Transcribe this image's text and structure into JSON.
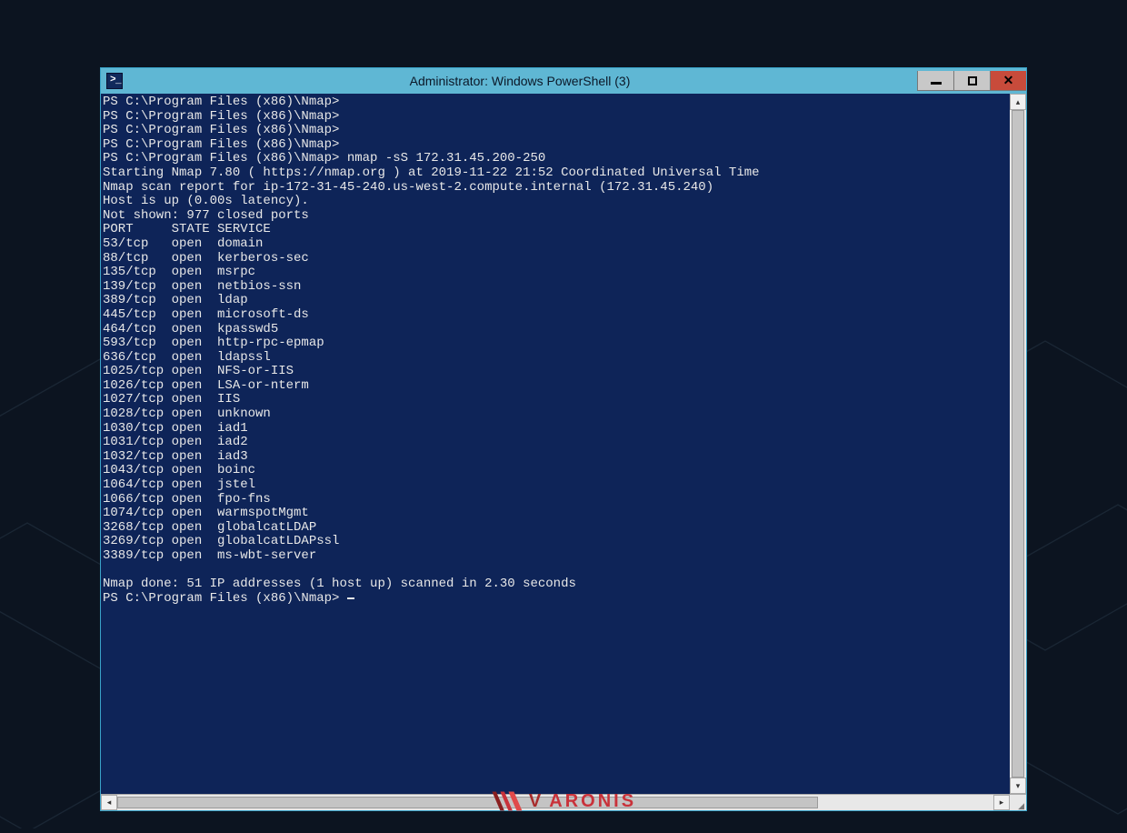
{
  "window": {
    "title": "Administrator: Windows PowerShell (3)"
  },
  "brand": {
    "letter": "V",
    "rest": "ARONIS"
  },
  "terminal": {
    "prompt": "PS C:\\Program Files (x86)\\Nmap>",
    "command": "nmap -sS 172.31.45.200-250",
    "start_line": "Starting Nmap 7.80 ( https://nmap.org ) at 2019-11-22 21:52 Coordinated Universal Time",
    "report_line": "Nmap scan report for ip-172-31-45-240.us-west-2.compute.internal (172.31.45.240)",
    "host_line": "Host is up (0.00s latency).",
    "notshown_line": "Not shown: 977 closed ports",
    "header": {
      "port": "PORT",
      "state": "STATE",
      "service": "SERVICE"
    },
    "ports": [
      {
        "port": "53/tcp",
        "state": "open",
        "service": "domain"
      },
      {
        "port": "88/tcp",
        "state": "open",
        "service": "kerberos-sec"
      },
      {
        "port": "135/tcp",
        "state": "open",
        "service": "msrpc"
      },
      {
        "port": "139/tcp",
        "state": "open",
        "service": "netbios-ssn"
      },
      {
        "port": "389/tcp",
        "state": "open",
        "service": "ldap"
      },
      {
        "port": "445/tcp",
        "state": "open",
        "service": "microsoft-ds"
      },
      {
        "port": "464/tcp",
        "state": "open",
        "service": "kpasswd5"
      },
      {
        "port": "593/tcp",
        "state": "open",
        "service": "http-rpc-epmap"
      },
      {
        "port": "636/tcp",
        "state": "open",
        "service": "ldapssl"
      },
      {
        "port": "1025/tcp",
        "state": "open",
        "service": "NFS-or-IIS"
      },
      {
        "port": "1026/tcp",
        "state": "open",
        "service": "LSA-or-nterm"
      },
      {
        "port": "1027/tcp",
        "state": "open",
        "service": "IIS"
      },
      {
        "port": "1028/tcp",
        "state": "open",
        "service": "unknown"
      },
      {
        "port": "1030/tcp",
        "state": "open",
        "service": "iad1"
      },
      {
        "port": "1031/tcp",
        "state": "open",
        "service": "iad2"
      },
      {
        "port": "1032/tcp",
        "state": "open",
        "service": "iad3"
      },
      {
        "port": "1043/tcp",
        "state": "open",
        "service": "boinc"
      },
      {
        "port": "1064/tcp",
        "state": "open",
        "service": "jstel"
      },
      {
        "port": "1066/tcp",
        "state": "open",
        "service": "fpo-fns"
      },
      {
        "port": "1074/tcp",
        "state": "open",
        "service": "warmspotMgmt"
      },
      {
        "port": "3268/tcp",
        "state": "open",
        "service": "globalcatLDAP"
      },
      {
        "port": "3269/tcp",
        "state": "open",
        "service": "globalcatLDAPssl"
      },
      {
        "port": "3389/tcp",
        "state": "open",
        "service": "ms-wbt-server"
      }
    ],
    "done_line": "Nmap done: 51 IP addresses (1 host up) scanned in 2.30 seconds"
  }
}
